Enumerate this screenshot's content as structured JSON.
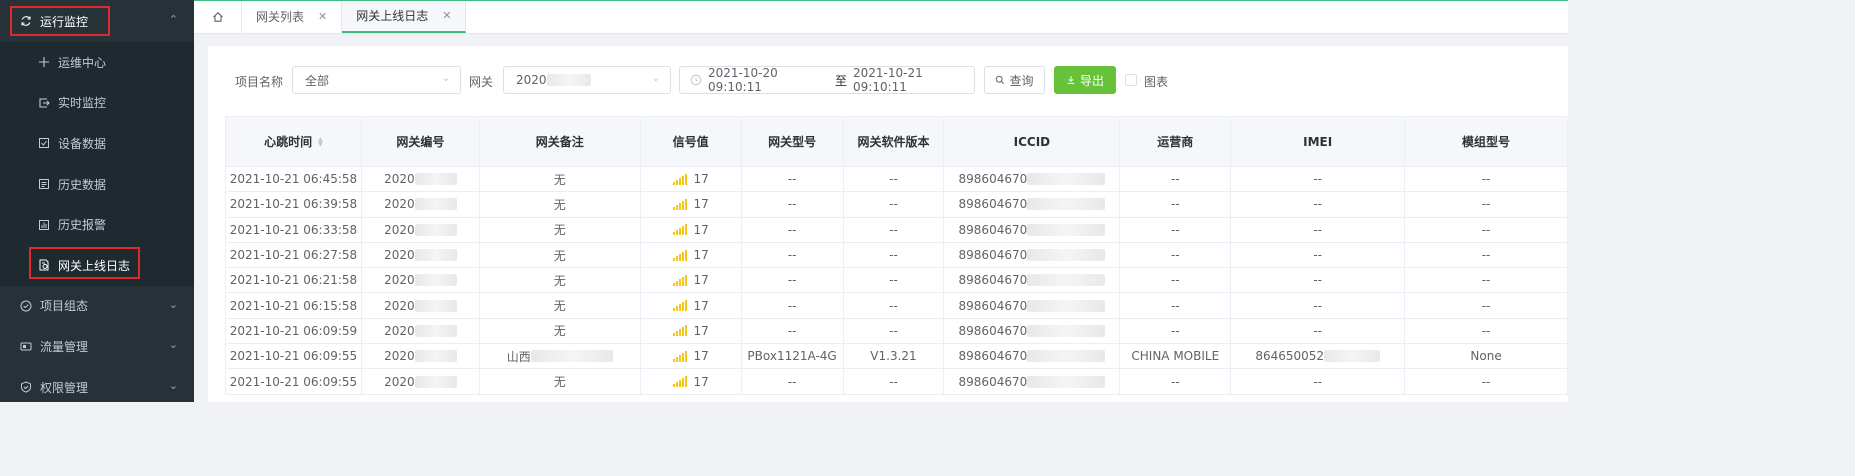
{
  "sidebar": {
    "top_group": {
      "label": "运行监控",
      "icon": "refresh-icon"
    },
    "sub_items": [
      {
        "label": "运维中心",
        "icon": "crosshair-icon"
      },
      {
        "label": "实时监控",
        "icon": "exit-icon"
      },
      {
        "label": "设备数据",
        "icon": "check-square-icon"
      },
      {
        "label": "历史数据",
        "icon": "list-icon"
      },
      {
        "label": "历史报警",
        "icon": "chart-icon"
      },
      {
        "label": "网关上线日志",
        "icon": "log-file-icon"
      }
    ],
    "groups": [
      {
        "label": "项目组态",
        "icon": "check-circle-icon"
      },
      {
        "label": "流量管理",
        "icon": "sim-card-icon"
      },
      {
        "label": "权限管理",
        "icon": "shield-icon"
      }
    ]
  },
  "tabs": [
    {
      "label": "网关列表"
    },
    {
      "label": "网关上线日志"
    }
  ],
  "filters": {
    "project_label": "项目名称",
    "project_value": "全部",
    "gateway_label": "网关",
    "gateway_value": "2020",
    "date_start": "2021-10-20 09:10:11",
    "date_sep": "至",
    "date_end": "2021-10-21 09:10:11",
    "query_label": "查询",
    "export_label": "导出",
    "chart_label": "图表"
  },
  "table": {
    "columns": [
      "心跳时间",
      "网关编号",
      "网关备注",
      "信号值",
      "网关型号",
      "网关软件版本",
      "ICCID",
      "运营商",
      "IMEI",
      "模组型号"
    ],
    "rows": [
      {
        "time": "2021-10-21 06:45:58",
        "gw": "2020",
        "remark": "无",
        "signal": "17",
        "model": "--",
        "ver": "--",
        "iccid": "898604670",
        "carrier": "--",
        "imei": "--",
        "module": "--"
      },
      {
        "time": "2021-10-21 06:39:58",
        "gw": "2020",
        "remark": "无",
        "signal": "17",
        "model": "--",
        "ver": "--",
        "iccid": "898604670",
        "carrier": "--",
        "imei": "--",
        "module": "--"
      },
      {
        "time": "2021-10-21 06:33:58",
        "gw": "2020",
        "remark": "无",
        "signal": "17",
        "model": "--",
        "ver": "--",
        "iccid": "898604670",
        "carrier": "--",
        "imei": "--",
        "module": "--"
      },
      {
        "time": "2021-10-21 06:27:58",
        "gw": "2020",
        "remark": "无",
        "signal": "17",
        "model": "--",
        "ver": "--",
        "iccid": "898604670",
        "carrier": "--",
        "imei": "--",
        "module": "--"
      },
      {
        "time": "2021-10-21 06:21:58",
        "gw": "2020",
        "remark": "无",
        "signal": "17",
        "model": "--",
        "ver": "--",
        "iccid": "898604670",
        "carrier": "--",
        "imei": "--",
        "module": "--"
      },
      {
        "time": "2021-10-21 06:15:58",
        "gw": "2020",
        "remark": "无",
        "signal": "17",
        "model": "--",
        "ver": "--",
        "iccid": "898604670",
        "carrier": "--",
        "imei": "--",
        "module": "--"
      },
      {
        "time": "2021-10-21 06:09:59",
        "gw": "2020",
        "remark": "无",
        "signal": "17",
        "model": "--",
        "ver": "--",
        "iccid": "898604670",
        "carrier": "--",
        "imei": "--",
        "module": "--"
      },
      {
        "time": "2021-10-21 06:09:55",
        "gw": "2020",
        "remark": "山西",
        "signal": "17",
        "model": "PBox1121A-4G",
        "ver": "V1.3.21",
        "iccid": "898604670",
        "carrier": "CHINA MOBILE",
        "imei": "864650052",
        "module": "None"
      },
      {
        "time": "2021-10-21 06:09:55",
        "gw": "2020",
        "remark": "无",
        "signal": "17",
        "model": "--",
        "ver": "--",
        "iccid": "898604670",
        "carrier": "--",
        "imei": "--",
        "module": "--"
      }
    ]
  },
  "colors": {
    "sidebar_bg": "#263238",
    "accent": "#42b983",
    "export_green": "#67c23a",
    "highlight_red": "#e0282e",
    "signal_yellow": "#f5c518"
  }
}
